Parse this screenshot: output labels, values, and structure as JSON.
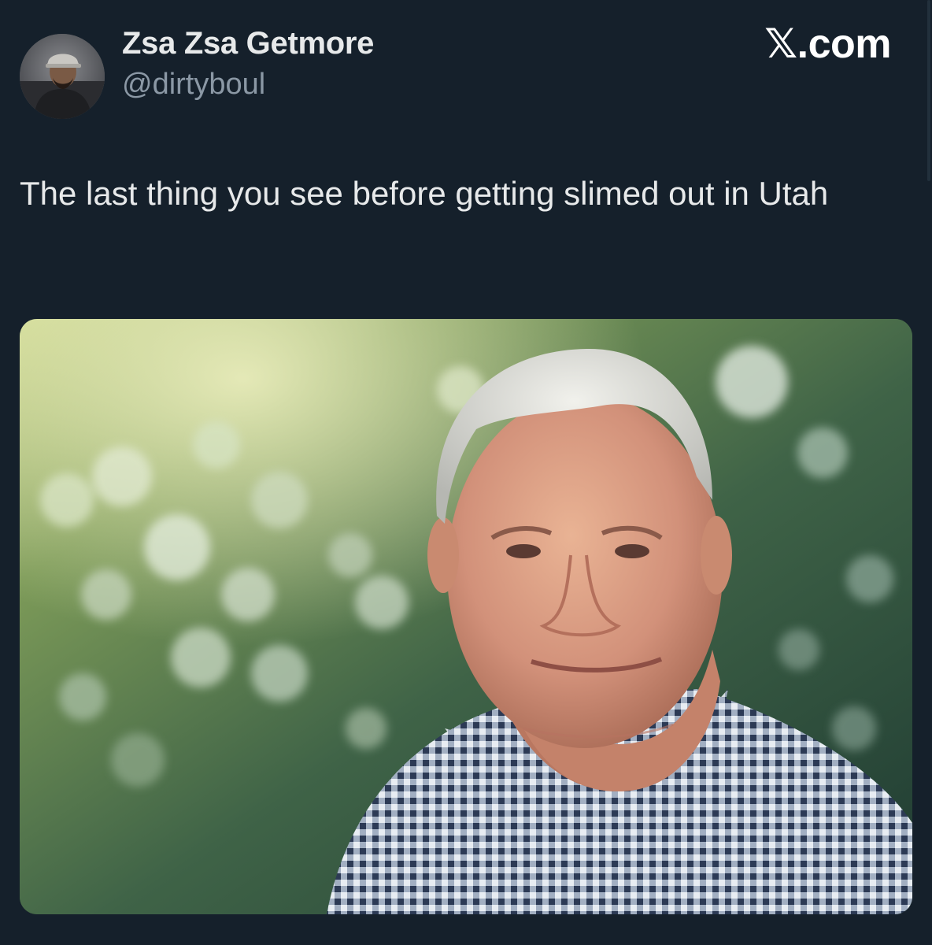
{
  "tweet": {
    "display_name": "Zsa Zsa Getmore",
    "handle": "@dirtyboul",
    "text": "The last thing you see before getting slimed out in Utah"
  },
  "brand": {
    "mark": "𝕏",
    "suffix": ".com"
  },
  "colors": {
    "background": "#15202b",
    "primary_text": "#e7e9ea",
    "secondary_text": "#8b98a5"
  },
  "icons": {
    "avatar": "profile-photo",
    "media": "photo-older-man-bokeh-background"
  }
}
